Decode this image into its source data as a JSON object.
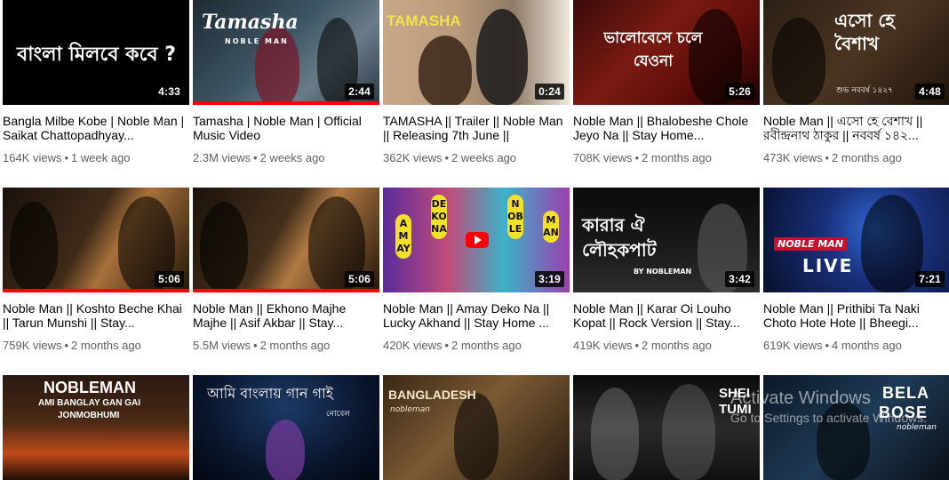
{
  "videos": [
    {
      "title": "Bangla Milbe Kobe | Noble Man | Saikat Chattopadhyay...",
      "views": "164K views",
      "age": "1 week ago",
      "duration": "4:33",
      "thumb_text": "বাংলা মিলবে কবে ?",
      "watched": 0
    },
    {
      "title": "Tamasha | Noble Man | Official Music Video",
      "views": "2.3M views",
      "age": "2 weeks ago",
      "duration": "2:44",
      "thumb_text": "Tamasha",
      "thumb_sub": "NOBLE MAN",
      "watched": 1
    },
    {
      "title": "TAMASHA || Trailer || Noble Man || Releasing 7th June ||",
      "views": "362K views",
      "age": "2 weeks ago",
      "duration": "0:24",
      "thumb_text": "TAMASHA",
      "watched": 0
    },
    {
      "title": "Noble Man || Bhalobeshe Chole Jeyo Na || Stay Home...",
      "views": "708K views",
      "age": "2 months ago",
      "duration": "5:26",
      "thumb_text": "ভালোবেসে চলে যেওনা",
      "watched": 0
    },
    {
      "title": "Noble Man || এসো হে বেশাখ || রবীন্দ্রনাথ ঠাকুর || নববর্ষ ১৪২...",
      "views": "473K views",
      "age": "2 months ago",
      "duration": "4:48",
      "thumb_text": "এসো হে বৈশাখ",
      "thumb_sub": "শুভ নববর্ষ ১৪২৭",
      "watched": 0
    },
    {
      "title": "Noble Man || Koshto Beche Khai || Tarun Munshi || Stay...",
      "views": "759K views",
      "age": "2 months ago",
      "duration": "5:06",
      "watched": 1
    },
    {
      "title": "Noble Man || Ekhono Majhe Majhe || Asif Akbar || Stay...",
      "views": "5.5M views",
      "age": "2 months ago",
      "duration": "5:06",
      "watched": 1
    },
    {
      "title": "Noble Man || Amay Deko Na || Lucky Akhand || Stay Home ...",
      "views": "420K views",
      "age": "2 months ago",
      "duration": "3:19",
      "thumb_words": [
        "AMAY",
        "DEKONA",
        "NOBLE",
        "MAN"
      ],
      "watched": 0
    },
    {
      "title": "Noble Man || Karar Oi Louho Kopat || Rock Version || Stay...",
      "views": "419K views",
      "age": "2 months ago",
      "duration": "3:42",
      "thumb_text": "কারার ঐ লৌহকপাট",
      "thumb_sub": "BY NOBLEMAN",
      "watched": 0
    },
    {
      "title": "Noble Man || Prithibi Ta Naki Choto Hote Hote || Bheegi...",
      "views": "619K views",
      "age": "4 months ago",
      "duration": "7:21",
      "thumb_text": "NOBLE MAN",
      "thumb_sub": "LIVE",
      "watched": 0
    },
    {
      "thumb_text": "NOBLEMAN",
      "thumb_sub": "AMI BANGLAY GAN GAI",
      "thumb_sub2": "JONMOBHUMI"
    },
    {
      "thumb_text": "আমি বাংলায় গান গাই",
      "thumb_sub": "নোবেল"
    },
    {
      "thumb_text": "BANGLADESH",
      "thumb_sub": "nobleman"
    },
    {
      "thumb_text": "SHEI",
      "thumb_sub": "TUMI"
    },
    {
      "thumb_text": "BELA",
      "thumb_sub": "BOSE",
      "thumb_sub2": "nobleman"
    }
  ],
  "watermark": {
    "line1": "Activate Windows",
    "line2": "Go to Settings to activate Windows."
  },
  "colors": {
    "progress": "#ff0000",
    "title": "#030303",
    "meta": "#606060"
  }
}
